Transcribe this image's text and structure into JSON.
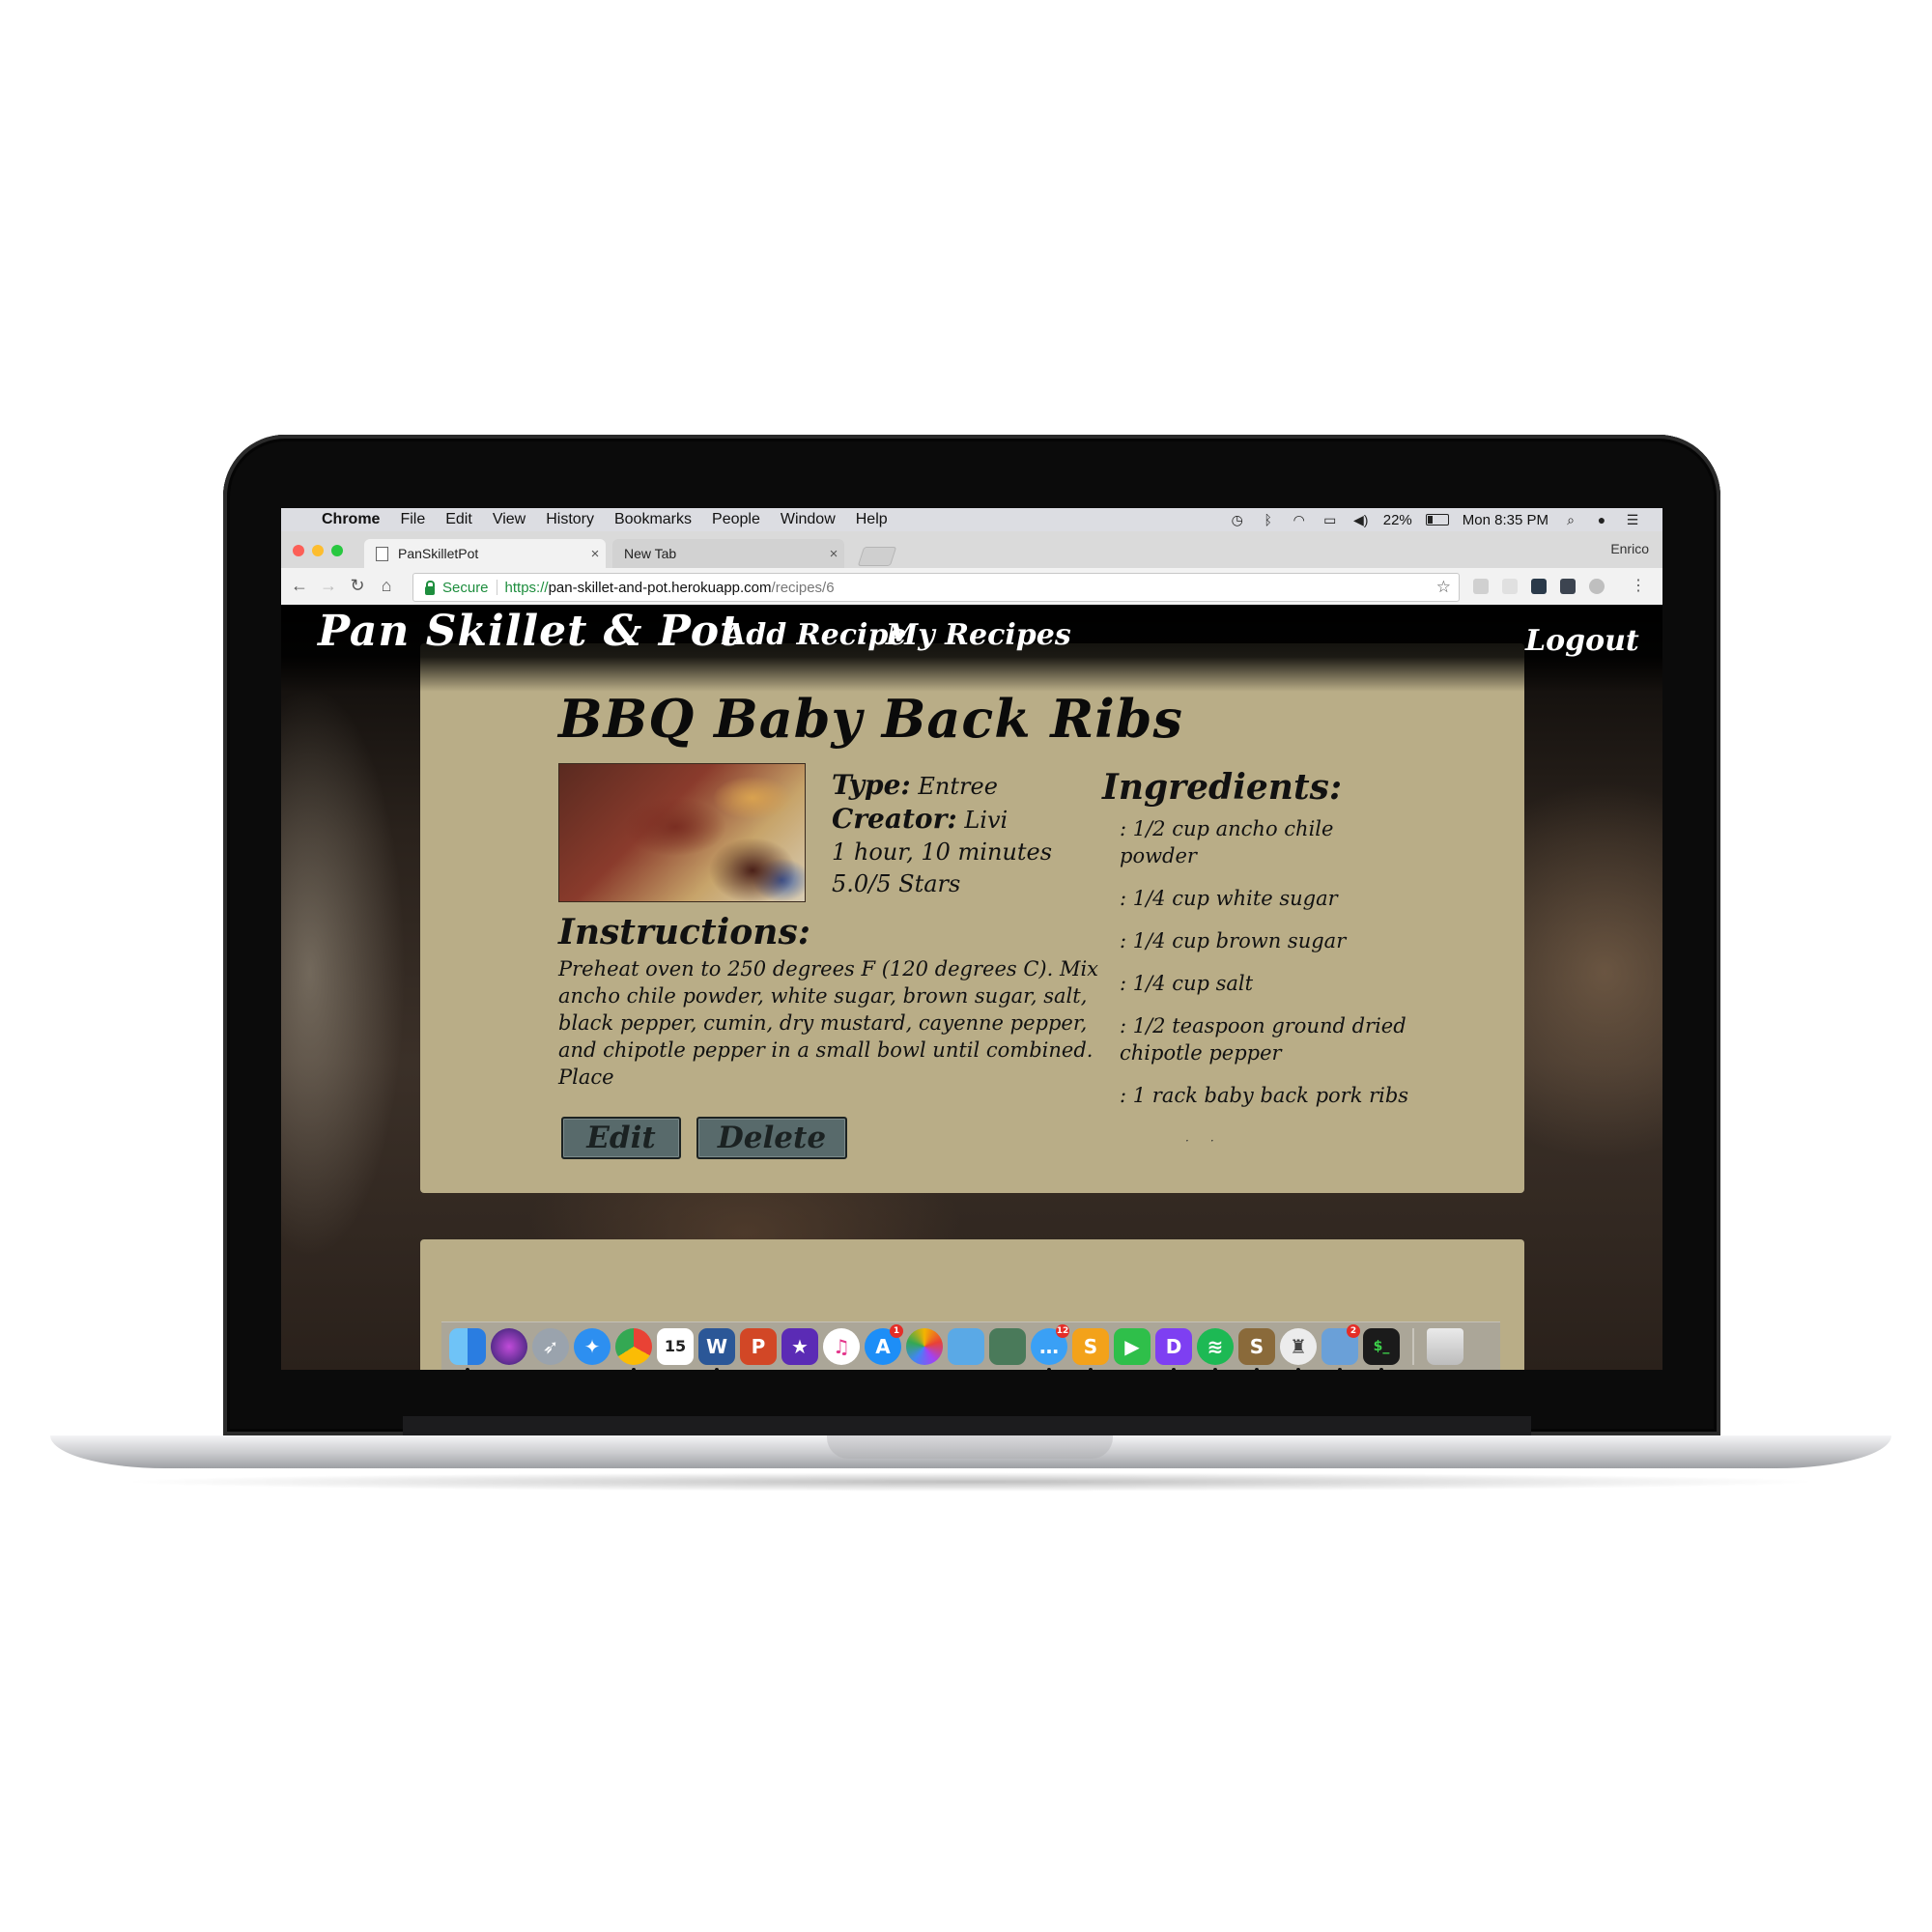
{
  "menubar": {
    "app_name": "Chrome",
    "items": [
      "File",
      "Edit",
      "View",
      "History",
      "Bookmarks",
      "People",
      "Window",
      "Help"
    ],
    "battery": "22%",
    "clock": "Mon 8:35 PM"
  },
  "browser": {
    "tabs": [
      {
        "label": "PanSkilletPot",
        "close": "×"
      },
      {
        "label": "New Tab",
        "close": "×"
      }
    ],
    "profile_name": "Enrico",
    "secure_label": "Secure",
    "url": {
      "scheme": "https://",
      "host": "pan-skillet-and-pot.herokuapp.com",
      "path": "/recipes/6"
    }
  },
  "site": {
    "brand": "Pan Skillet & Pot",
    "nav": {
      "add_recipe": "Add Recipe",
      "my_recipes": "My Recipes",
      "logout": "Logout"
    }
  },
  "recipe": {
    "title": "BBQ Baby Back Ribs",
    "type_label": "Type:",
    "type_value": "Entree",
    "creator_label": "Creator:",
    "creator_value": "Livi",
    "duration": "1 hour, 10 minutes",
    "rating": "5.0/5 Stars",
    "instructions_heading": "Instructions:",
    "instructions": "Preheat oven to 250 degrees F (120 degrees C). Mix ancho chile powder, white sugar, brown sugar, salt, black pepper, cumin, dry mustard, cayenne pepper, and chipotle pepper in a small bowl until combined. Place",
    "ingredients_heading": "Ingredients:",
    "ingredients": [
      ": 1/2 cup ancho chile powder",
      ": 1/4 cup white sugar",
      ": 1/4 cup brown sugar",
      ": 1/4 cup salt",
      ": 1/2 teaspoon ground dried chipotle pepper",
      ": 1 rack baby back pork ribs"
    ],
    "edit_label": "Edit",
    "delete_label": "Delete"
  },
  "dock": {
    "calendar_day": "15",
    "messages_badge": "12",
    "appstore_badge": "1",
    "preview_badge": "2"
  }
}
